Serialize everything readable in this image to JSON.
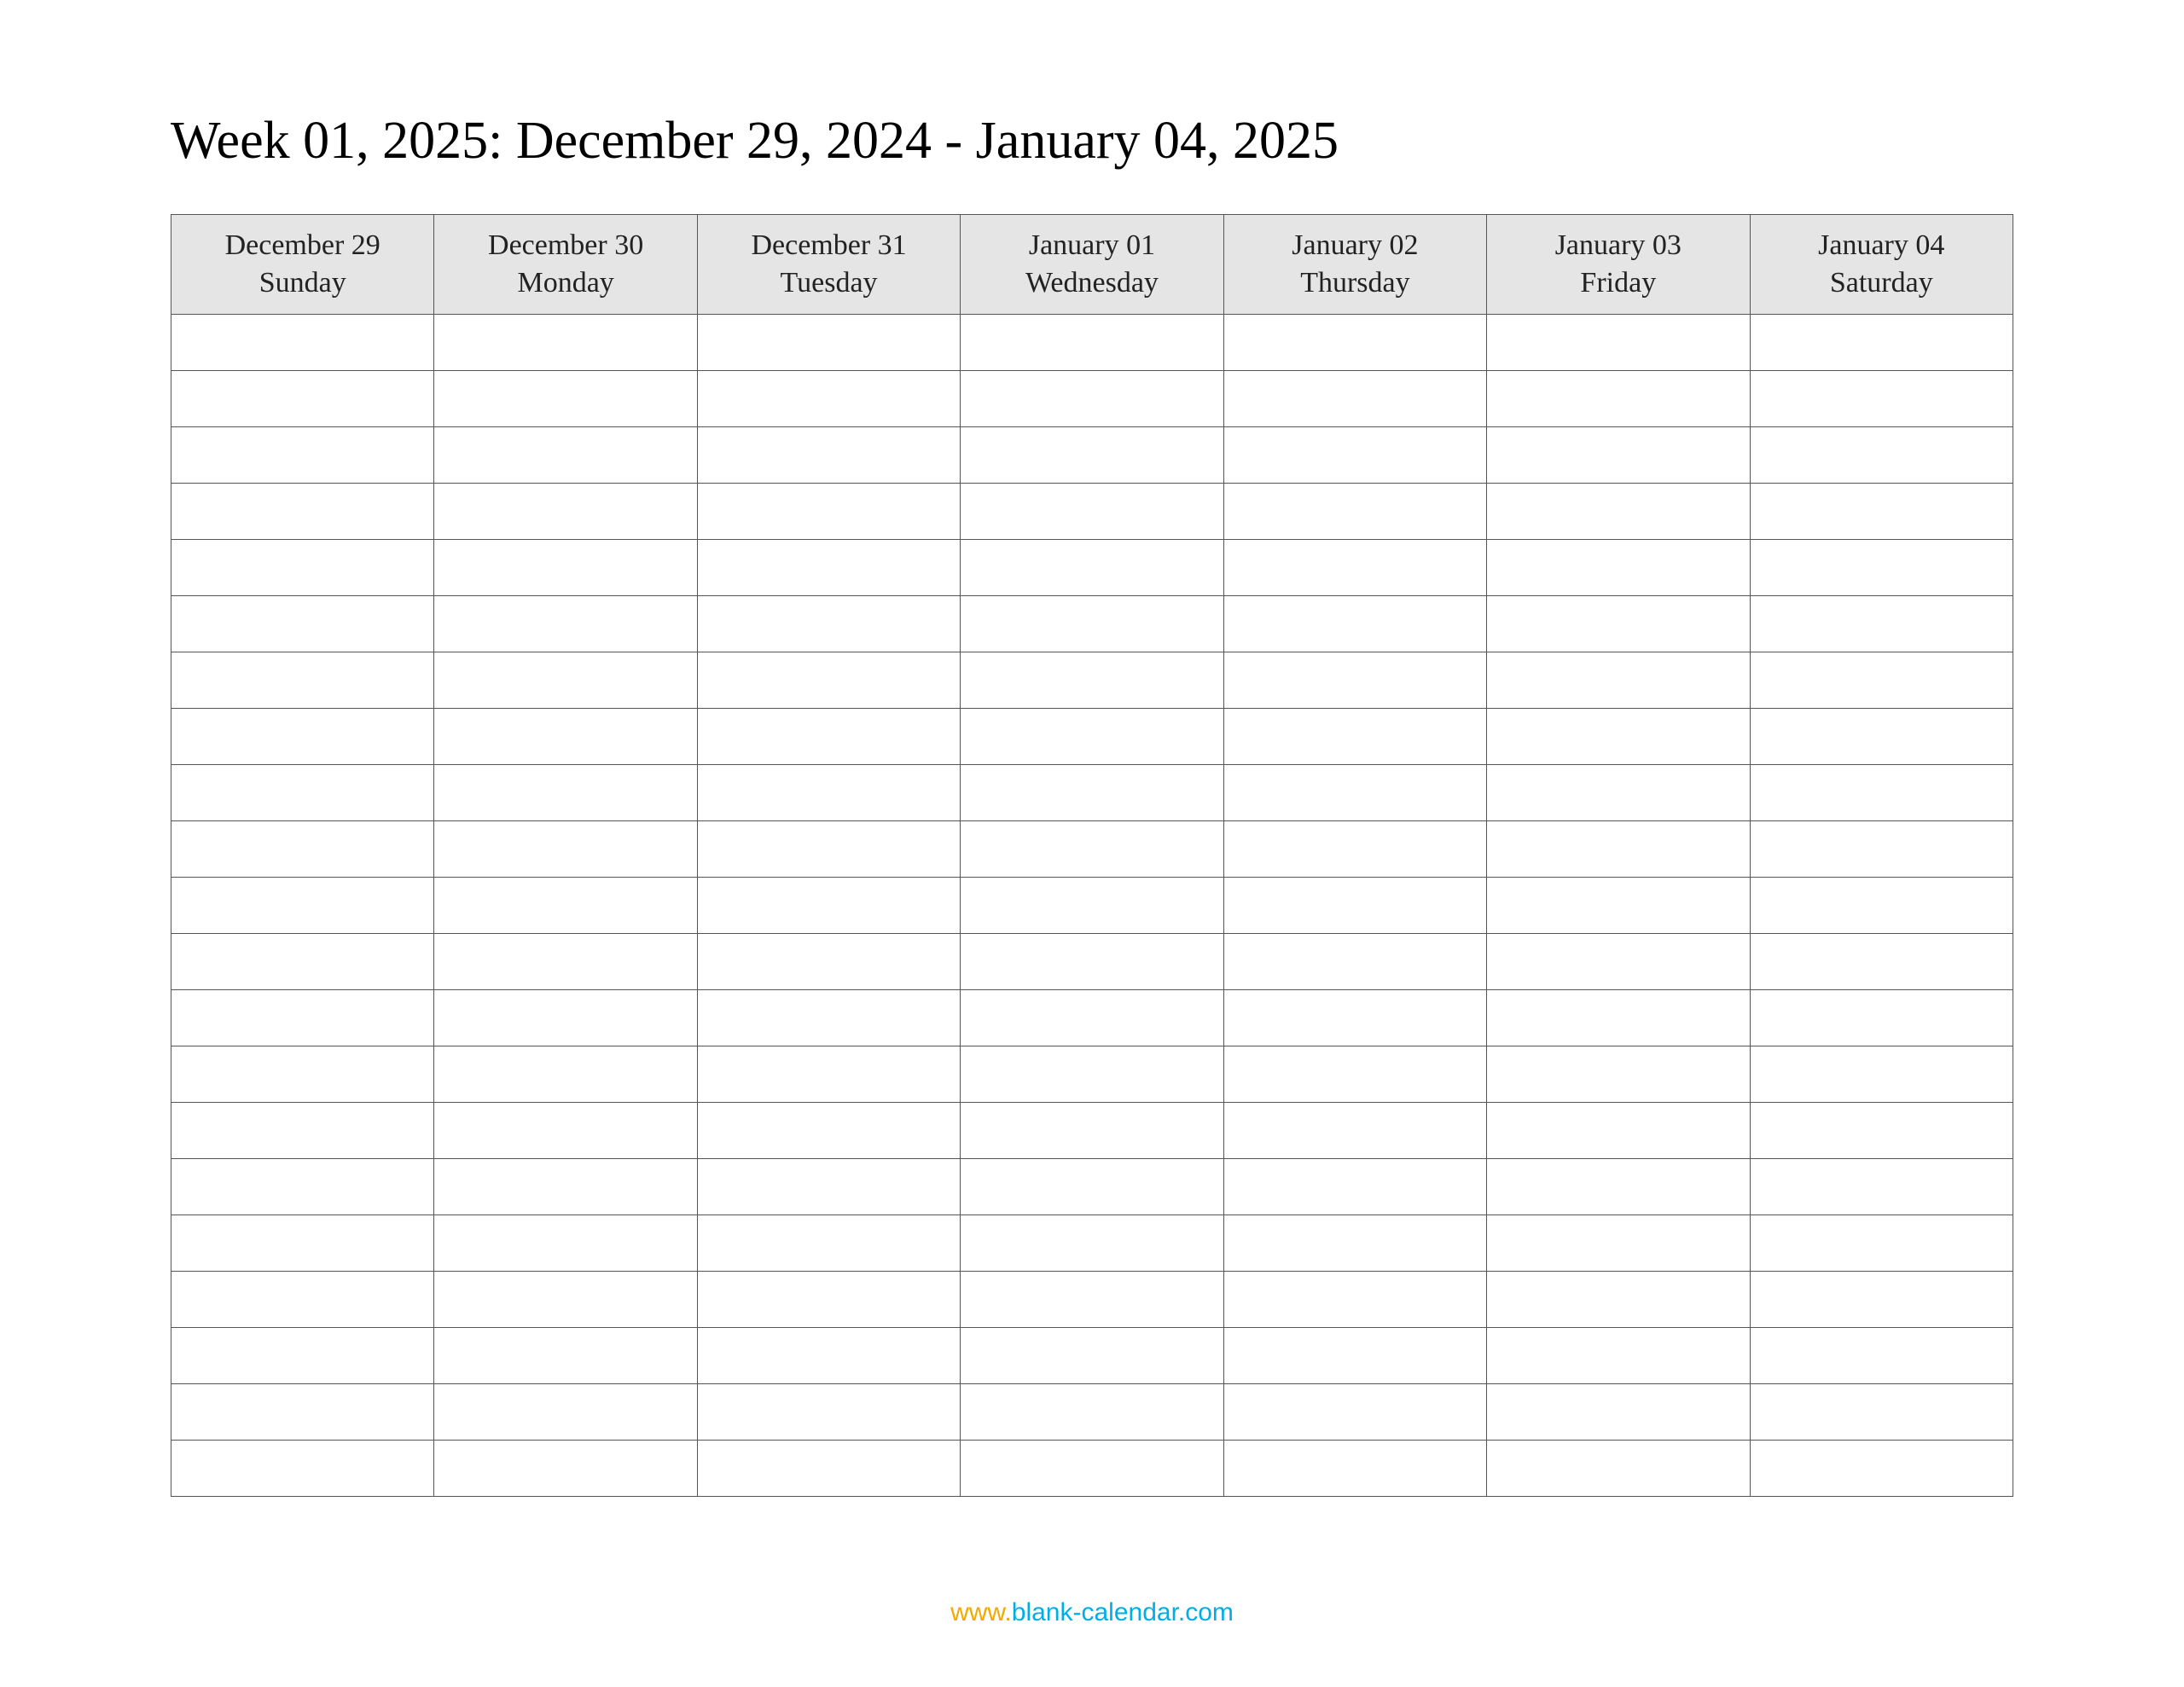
{
  "title": "Week 01, 2025: December 29, 2024 - January 04, 2025",
  "columns": [
    {
      "date": "December 29",
      "day": "Sunday"
    },
    {
      "date": "December 30",
      "day": "Monday"
    },
    {
      "date": "December 31",
      "day": "Tuesday"
    },
    {
      "date": "January 01",
      "day": "Wednesday"
    },
    {
      "date": "January 02",
      "day": "Thursday"
    },
    {
      "date": "January 03",
      "day": "Friday"
    },
    {
      "date": "January 04",
      "day": "Saturday"
    }
  ],
  "row_count": 21,
  "footer": {
    "www": "www.",
    "domain": "blank-calendar.com"
  }
}
